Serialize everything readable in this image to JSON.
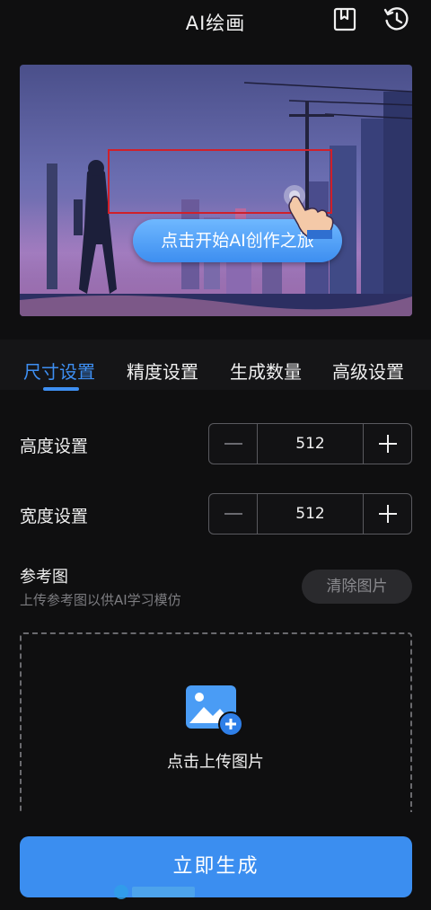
{
  "header": {
    "title": "AI绘画",
    "bookmark_icon": "bookmark-icon",
    "history_icon": "history-clock-icon"
  },
  "banner": {
    "cta_label": "点击开始AI创作之旅",
    "highlight_color": "#d0202a",
    "cta_color": "#3d8ef0"
  },
  "tabs": [
    {
      "label": "尺寸设置",
      "active": true
    },
    {
      "label": "精度设置",
      "active": false
    },
    {
      "label": "生成数量",
      "active": false
    },
    {
      "label": "高级设置",
      "active": false
    }
  ],
  "settings": {
    "height": {
      "label": "高度设置",
      "value": "512"
    },
    "width": {
      "label": "宽度设置",
      "value": "512"
    }
  },
  "reference": {
    "title": "参考图",
    "subtitle": "上传参考图以供AI学习模仿",
    "clear_label": "清除图片",
    "upload_label": "点击上传图片",
    "upload_icon": "image-add-icon"
  },
  "footer": {
    "generate_label": "立即生成"
  },
  "colors": {
    "accent": "#3e8ff2",
    "background": "#0f0f10"
  }
}
